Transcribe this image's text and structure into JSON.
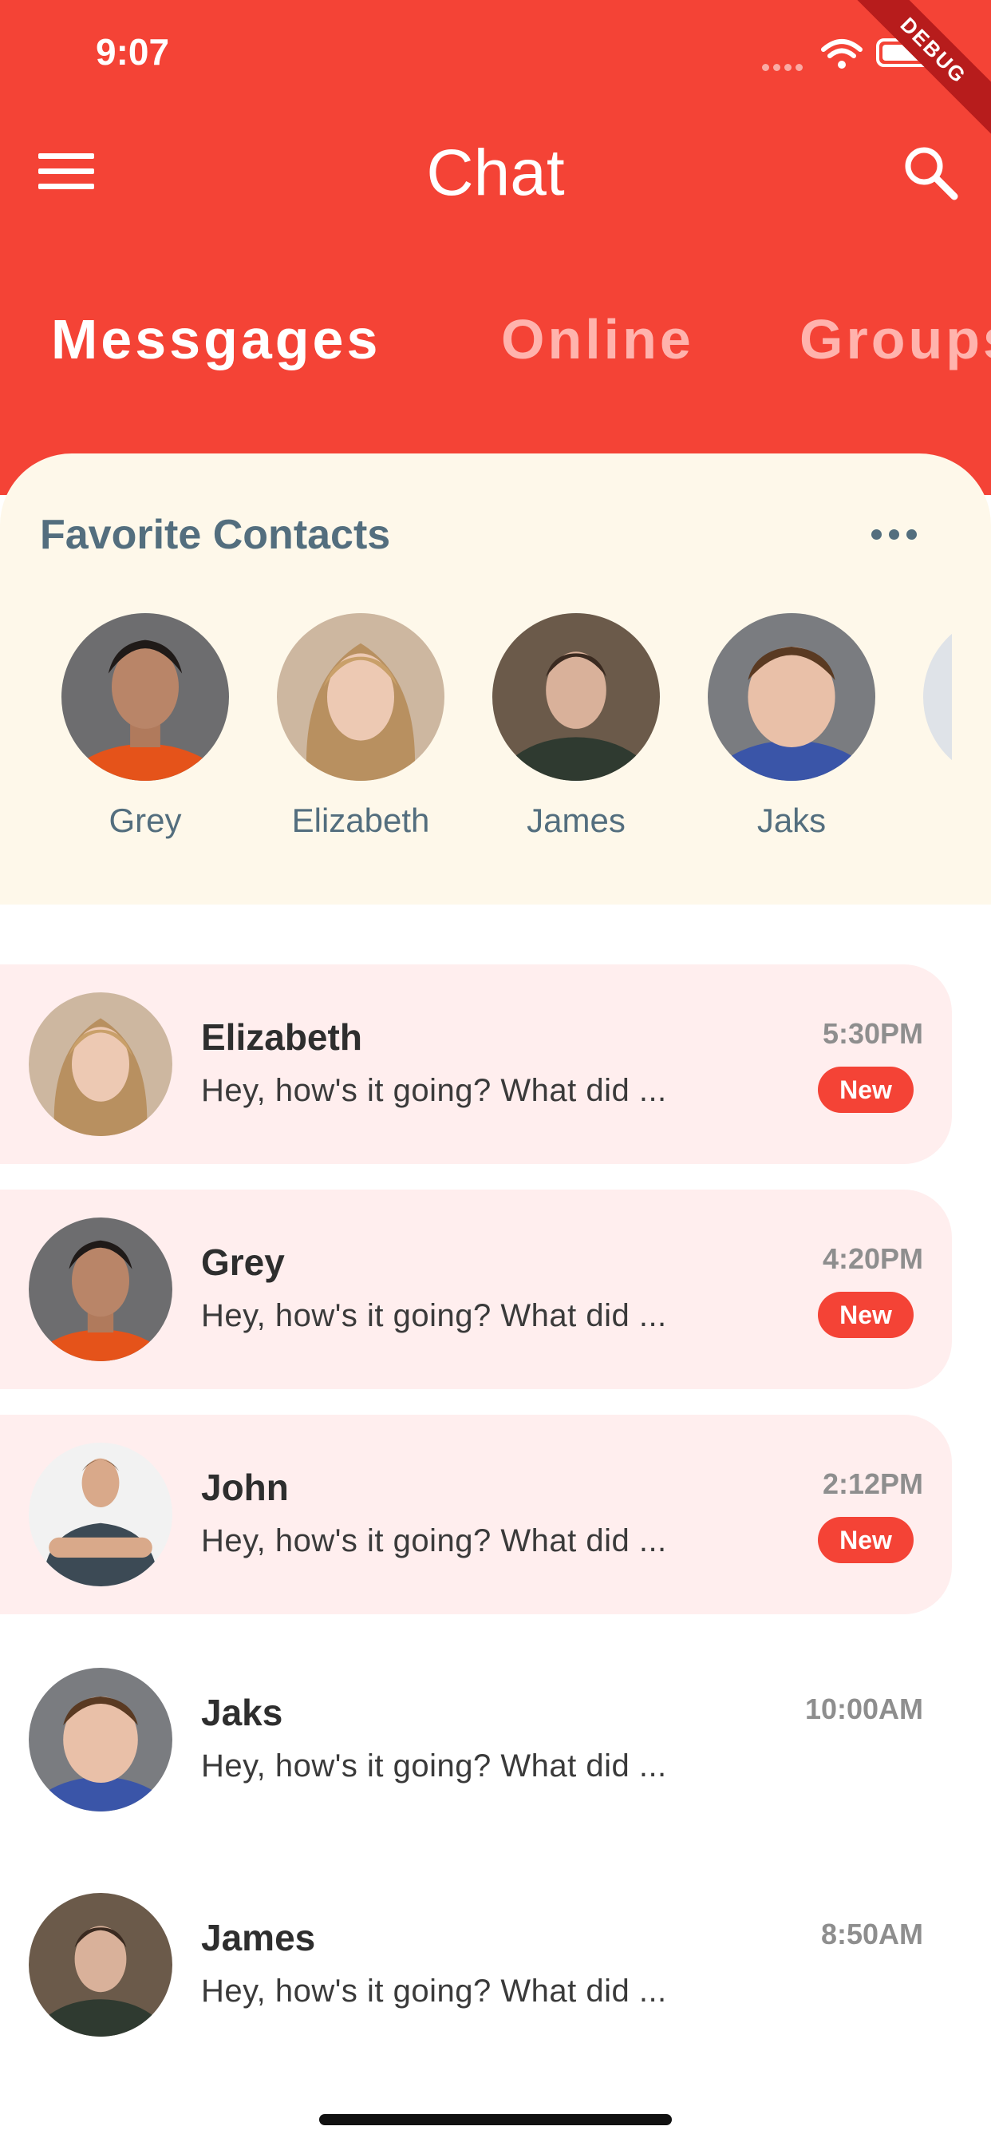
{
  "status_bar": {
    "time": "9:07",
    "debug_label": "DEBUG"
  },
  "header": {
    "title": "Chat"
  },
  "tabs": [
    {
      "label": "Messgages",
      "active": true
    },
    {
      "label": "Online",
      "active": false
    },
    {
      "label": "Groups",
      "active": false
    }
  ],
  "favorites": {
    "title": "Favorite Contacts",
    "contacts": [
      {
        "name": "Grey"
      },
      {
        "name": "Elizabeth"
      },
      {
        "name": "James"
      },
      {
        "name": "Jaks"
      },
      {
        "name": ""
      }
    ]
  },
  "chats": [
    {
      "name": "Elizabeth",
      "preview": "Hey, how's it going? What did ...",
      "time": "5:30PM",
      "badge": "New",
      "unread": true
    },
    {
      "name": "Grey",
      "preview": "Hey, how's it going? What did ...",
      "time": "4:20PM",
      "badge": "New",
      "unread": true
    },
    {
      "name": "John",
      "preview": "Hey, how's it going? What did ...",
      "time": "2:12PM",
      "badge": "New",
      "unread": true
    },
    {
      "name": "Jaks",
      "preview": "Hey, how's it going? What did ...",
      "time": "10:00AM",
      "badge": "",
      "unread": false
    },
    {
      "name": "James",
      "preview": "Hey, how's it going? What did ...",
      "time": "8:50AM",
      "badge": "",
      "unread": false
    }
  ],
  "colors": {
    "primary": "#f44336",
    "favorites_bg": "#fef8ea",
    "unread_bg": "#ffeeee",
    "muted_text": "#536e7e"
  },
  "icons": [
    "menu-icon",
    "search-icon",
    "more-icon",
    "wifi-icon",
    "battery-icon",
    "signal-icon"
  ]
}
